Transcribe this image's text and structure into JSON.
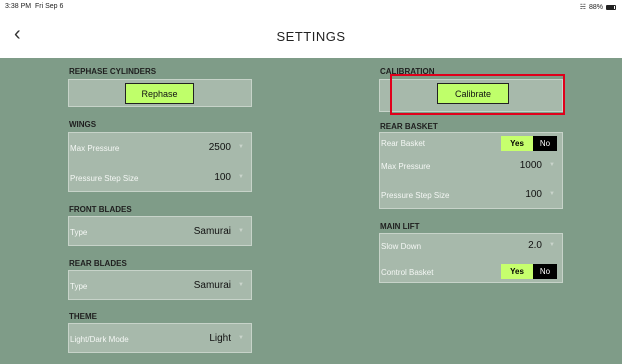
{
  "status": {
    "time": "3:38 PM",
    "date": "Fri Sep 6",
    "battery": "88%",
    "battery_level": 0.88
  },
  "header": {
    "title": "SETTINGS",
    "back_icon": "chevron-left-icon"
  },
  "rephase": {
    "title": "REPHASE CYLINDERS",
    "button": "Rephase"
  },
  "wings": {
    "title": "WINGS",
    "max_pressure_label": "Max Pressure",
    "max_pressure_value": "2500",
    "step_label": "Pressure Step Size",
    "step_value": "100"
  },
  "front_blades": {
    "title": "FRONT BLADES",
    "type_label": "Type",
    "type_value": "Samurai"
  },
  "rear_blades": {
    "title": "REAR BLADES",
    "type_label": "Type",
    "type_value": "Samurai"
  },
  "theme": {
    "title": "THEME",
    "mode_label": "Light/Dark Mode",
    "mode_value": "Light"
  },
  "calibration": {
    "title": "CALIBRATION",
    "button": "Calibrate"
  },
  "rear_basket": {
    "title": "REAR BASKET",
    "basket_label": "Rear Basket",
    "yes": "Yes",
    "no": "No",
    "max_pressure_label": "Max Pressure",
    "max_pressure_value": "1000",
    "step_label": "Pressure Step Size",
    "step_value": "100"
  },
  "main_lift": {
    "title": "MAIN LIFT",
    "slow_label": "Slow Down",
    "slow_value": "2.0",
    "control_label": "Control Basket",
    "yes": "Yes",
    "no": "No"
  },
  "colors": {
    "accent": "#bfff6a",
    "background": "#7f9c88",
    "card": "#a7b9ab",
    "highlight": "#e0001b"
  }
}
